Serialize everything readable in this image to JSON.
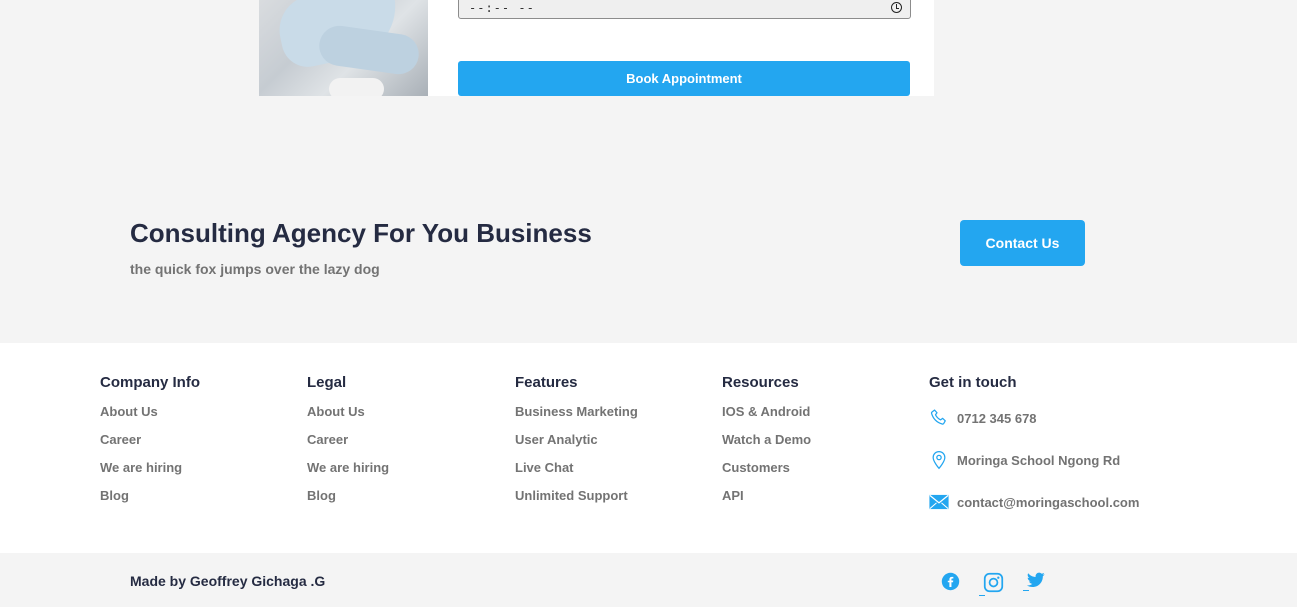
{
  "booking": {
    "time_value": "--:-- --",
    "book_label": "Book Appointment"
  },
  "cta": {
    "title": "Consulting Agency For You Business",
    "subtitle": "the quick fox jumps over the lazy dog",
    "contact_label": "Contact Us"
  },
  "footer": {
    "company": {
      "title": "Company Info",
      "links": [
        "About Us",
        "Career",
        "We are hiring",
        "Blog"
      ]
    },
    "legal": {
      "title": "Legal",
      "links": [
        "About Us",
        "Career",
        "We are hiring",
        "Blog"
      ]
    },
    "features": {
      "title": "Features",
      "links": [
        "Business Marketing",
        "User Analytic",
        "Live Chat",
        "Unlimited Support"
      ]
    },
    "resources": {
      "title": "Resources",
      "links": [
        "IOS & Android",
        "Watch a Demo",
        "Customers",
        "API"
      ]
    },
    "contact": {
      "title": "Get in touch",
      "phone": "0712 345 678",
      "address": "Moringa School Ngong Rd",
      "email": "contact@moringaschool.com"
    }
  },
  "bottom": {
    "made_by": "Made by Geoffrey Gichaga .G",
    "social_icons": [
      "facebook-icon",
      "instagram-icon",
      "twitter-icon"
    ]
  },
  "colors": {
    "accent": "#23a6f0",
    "heading": "#252b42",
    "muted": "#737373",
    "background": "#f4f4f4"
  }
}
